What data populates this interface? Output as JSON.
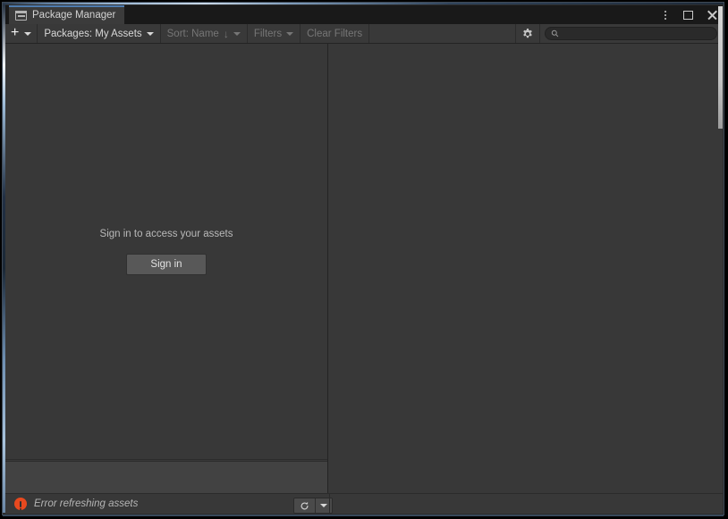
{
  "window": {
    "tab_title": "Package Manager",
    "tab_icon": "package-box-icon",
    "controls": {
      "menu_icon": "vertical-dots-icon",
      "maximize_icon": "maximize-square-icon",
      "close_icon": "close-x-icon"
    }
  },
  "toolbar": {
    "add_label": "+",
    "add_icon": "plus-icon",
    "add_caret_icon": "chevron-down-icon",
    "packages_label": "Packages: My Assets",
    "packages_caret_icon": "chevron-down-icon",
    "sort_label": "Sort: Name",
    "sort_direction_glyph": "↓",
    "sort_caret_icon": "chevron-down-icon",
    "filters_label": "Filters",
    "filters_caret_icon": "chevron-down-icon",
    "clear_filters_label": "Clear Filters",
    "gear_icon": "gear-icon",
    "search_icon": "search-icon",
    "search_value": "",
    "search_placeholder": ""
  },
  "list_panel": {
    "signin_message": "Sign in to access your assets",
    "signin_button_label": "Sign in"
  },
  "status_bar": {
    "error_icon": "error-circle-icon",
    "message": "Error refreshing assets",
    "refresh_icon": "refresh-circular-arrow-icon",
    "refresh_caret_icon": "chevron-down-icon"
  },
  "colors": {
    "window_background": "#2c2c2c",
    "panel_background": "#383838",
    "toolbar_background": "#393939",
    "titlebar_background": "#191919",
    "tab_background": "#3b3b3b",
    "tab_accent": "#4f7cb0",
    "error_accent": "#e8491f",
    "button_background": "#585858",
    "disabled_text": "#767676",
    "primary_text": "#d8d8d8"
  }
}
